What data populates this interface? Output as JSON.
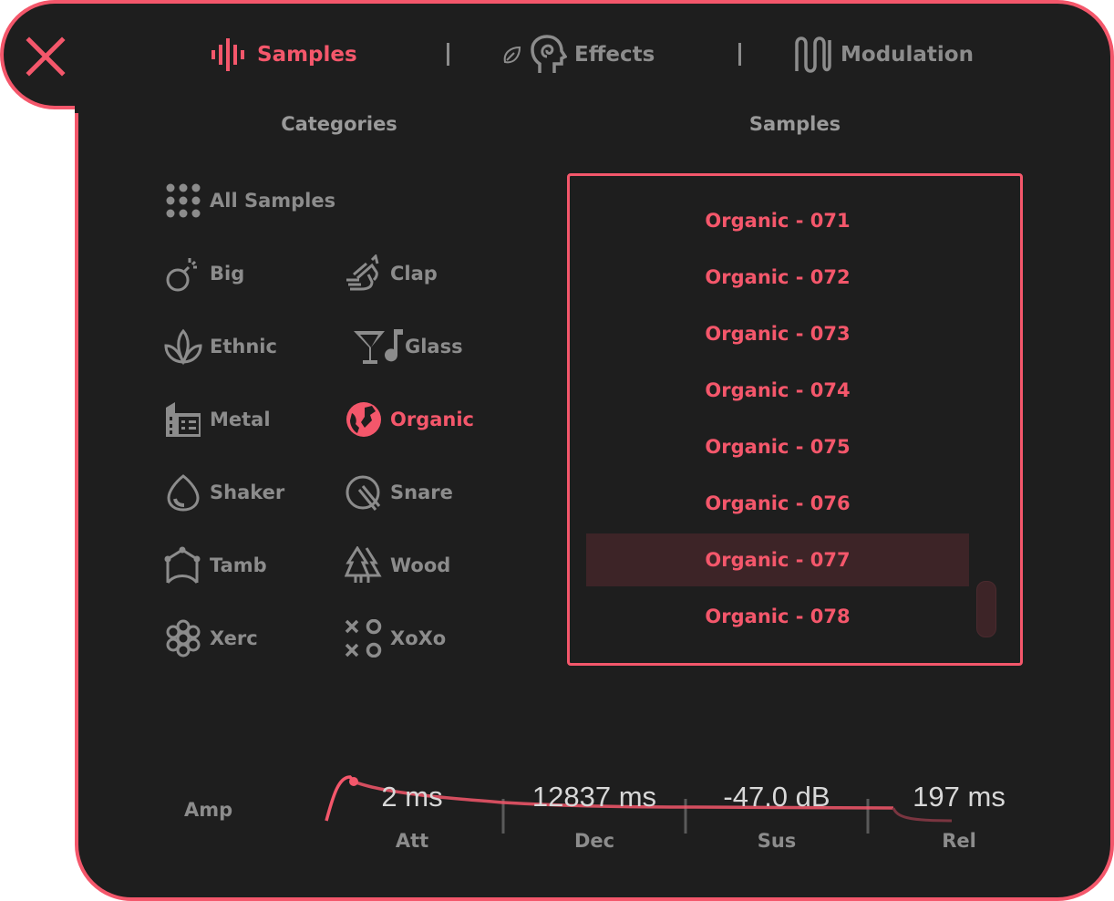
{
  "colors": {
    "accent": "#f4576b",
    "background": "#1e1e1e",
    "muted": "#8c8c8c",
    "selected_bg": "#3d2427"
  },
  "nav": {
    "samples": "Samples",
    "effects": "Effects",
    "modulation": "Modulation",
    "active": "Samples"
  },
  "categories": {
    "title": "Categories",
    "all": "All Samples",
    "items": [
      "Big",
      "Clap",
      "Ethnic",
      "Glass",
      "Metal",
      "Organic",
      "Shaker",
      "Snare",
      "Tamb",
      "Wood",
      "Xerc",
      "XoXo"
    ],
    "active": "Organic"
  },
  "samples": {
    "title": "Samples",
    "items": [
      "Organic - 071",
      "Organic - 072",
      "Organic - 073",
      "Organic - 074",
      "Organic - 075",
      "Organic - 076",
      "Organic - 077",
      "Organic - 078"
    ],
    "selected": "Organic - 077"
  },
  "envelope": {
    "label": "Amp",
    "attack": {
      "value": "2 ms",
      "label": "Att"
    },
    "decay": {
      "value": "12837 ms",
      "label": "Dec"
    },
    "sustain": {
      "value": "-47.0 dB",
      "label": "Sus"
    },
    "release": {
      "value": "197 ms",
      "label": "Rel"
    }
  }
}
